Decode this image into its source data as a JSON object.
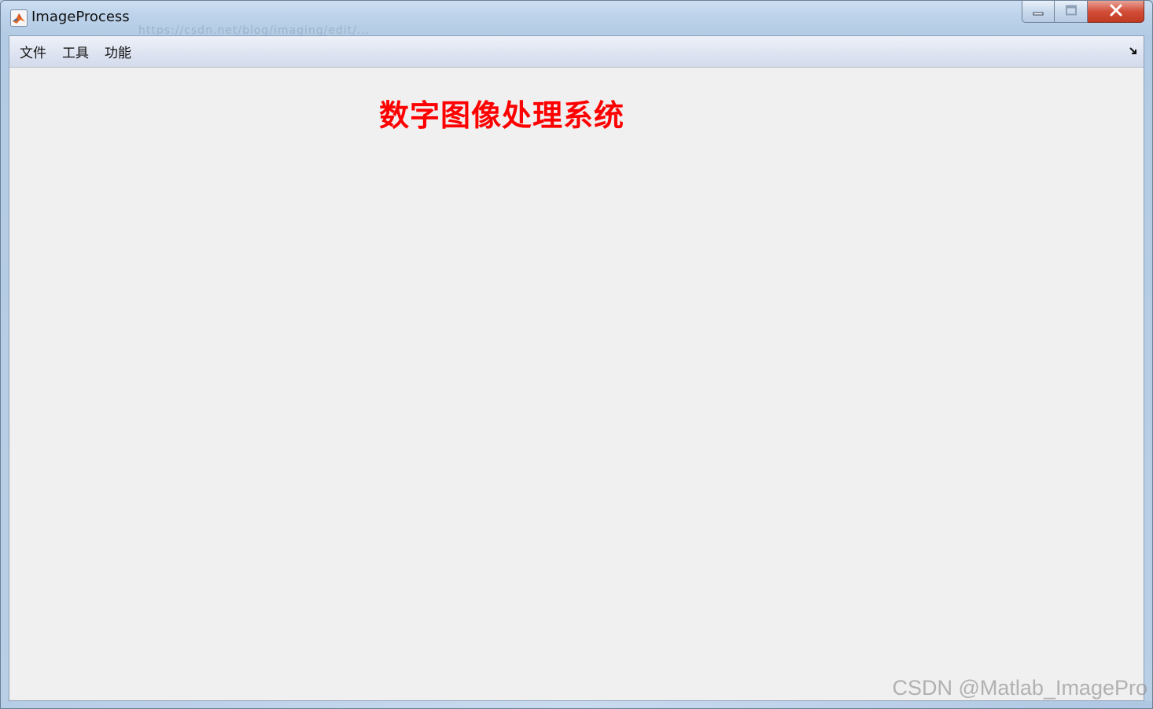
{
  "window": {
    "title": "ImageProcess",
    "background_ghost_text": "https://csdn.net/blog/imaging/edit/..."
  },
  "caption_buttons": {
    "minimize_icon": "minimize-icon",
    "maximize_icon": "maximize-icon",
    "close_icon": "close-icon"
  },
  "menubar": {
    "items": [
      {
        "label": "文件"
      },
      {
        "label": "工具"
      },
      {
        "label": "功能"
      }
    ],
    "dock_icon": "undock-arrow-icon"
  },
  "main": {
    "heading": "数字图像处理系统",
    "heading_color": "#ff0000",
    "background_color": "#f0f0f0"
  },
  "watermark": "CSDN @Matlab_ImagePro"
}
